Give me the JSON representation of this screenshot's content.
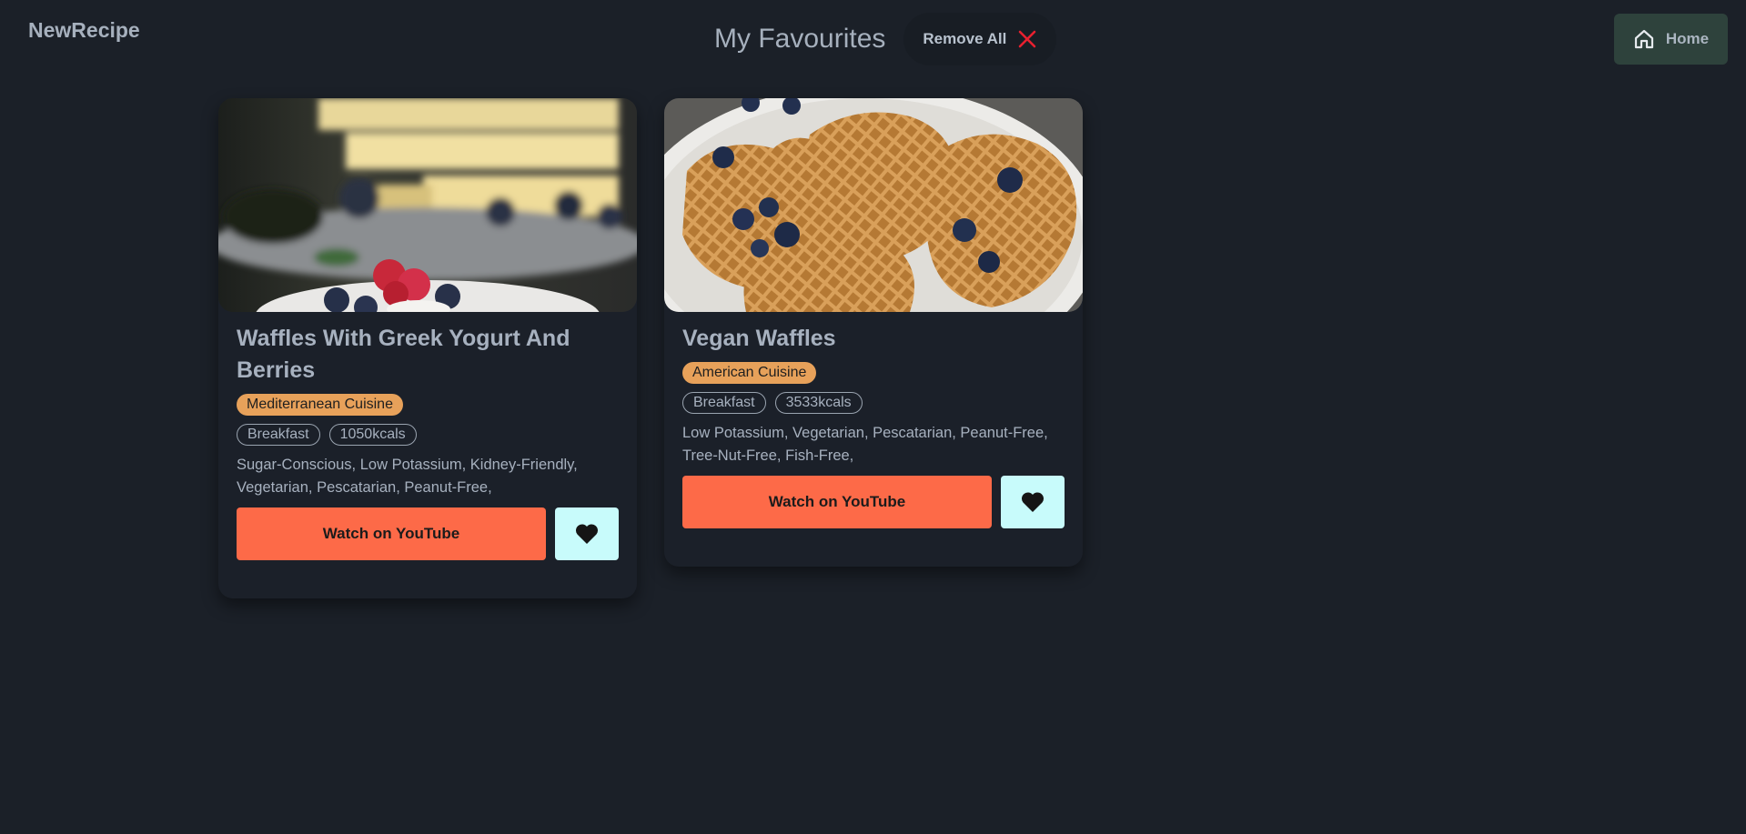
{
  "header": {
    "brand": "NewRecipe",
    "title": "My Favourites",
    "remove_all_label": "Remove All",
    "home_label": "Home"
  },
  "cards": [
    {
      "title": "Waffles With Greek Yogurt And Berries",
      "cuisine": "Mediterranean Cuisine",
      "meal_type": "Breakfast",
      "calories": "1050kcals",
      "health_labels": "Sugar-Conscious, Low Potassium, Kidney-Friendly, Vegetarian, Pescatarian, Peanut-Free,",
      "youtube_label": "Watch on YouTube"
    },
    {
      "title": "Vegan Waffles",
      "cuisine": "American Cuisine",
      "meal_type": "Breakfast",
      "calories": "3533kcals",
      "health_labels": "Low Potassium, Vegetarian, Pescatarian, Peanut-Free, Tree-Nut-Free, Fish-Free,",
      "youtube_label": "Watch on YouTube"
    }
  ],
  "icons": {
    "remove": "close-icon",
    "home": "home-icon",
    "favourite": "heart-icon"
  },
  "colors": {
    "background": "#1b2028",
    "youtube_button": "#fd6a48",
    "favourite_button": "#c8fbfb",
    "cuisine_badge": "#e7a15a",
    "home_button": "#2e423c",
    "remove_icon": "#e8202f"
  }
}
